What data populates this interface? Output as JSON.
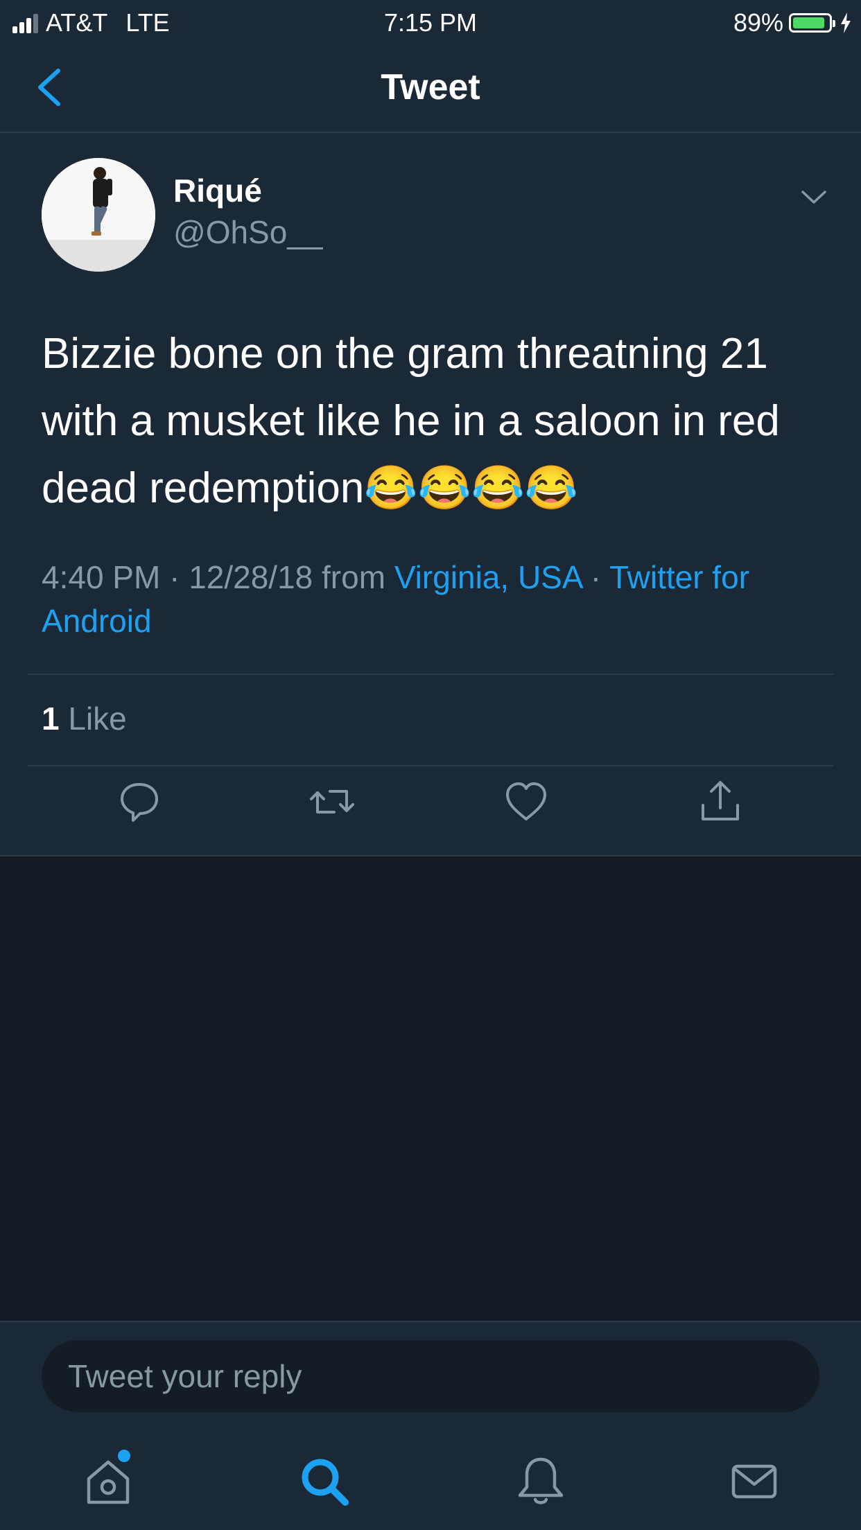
{
  "status_bar": {
    "carrier": "AT&T",
    "network": "LTE",
    "time": "7:15 PM",
    "battery": "89%",
    "battery_level": 0.89
  },
  "nav": {
    "title": "Tweet"
  },
  "tweet": {
    "name": "Riqué",
    "handle": "@OhSo__",
    "text": "Bizzie bone on the gram threatning 21 with a musket like he in a saloon in red dead redemption😂😂😂😂",
    "time": "4:40 PM · 12/28/18 from ",
    "location": "Virginia, USA",
    "separator": " · ",
    "source": "Twitter for Android",
    "likes_count": "1",
    "likes_label": " Like"
  },
  "composer": {
    "placeholder": "Tweet your reply"
  },
  "colors": {
    "accent": "#1da1f2",
    "background": "#1b2836",
    "muted": "#8899a6"
  }
}
